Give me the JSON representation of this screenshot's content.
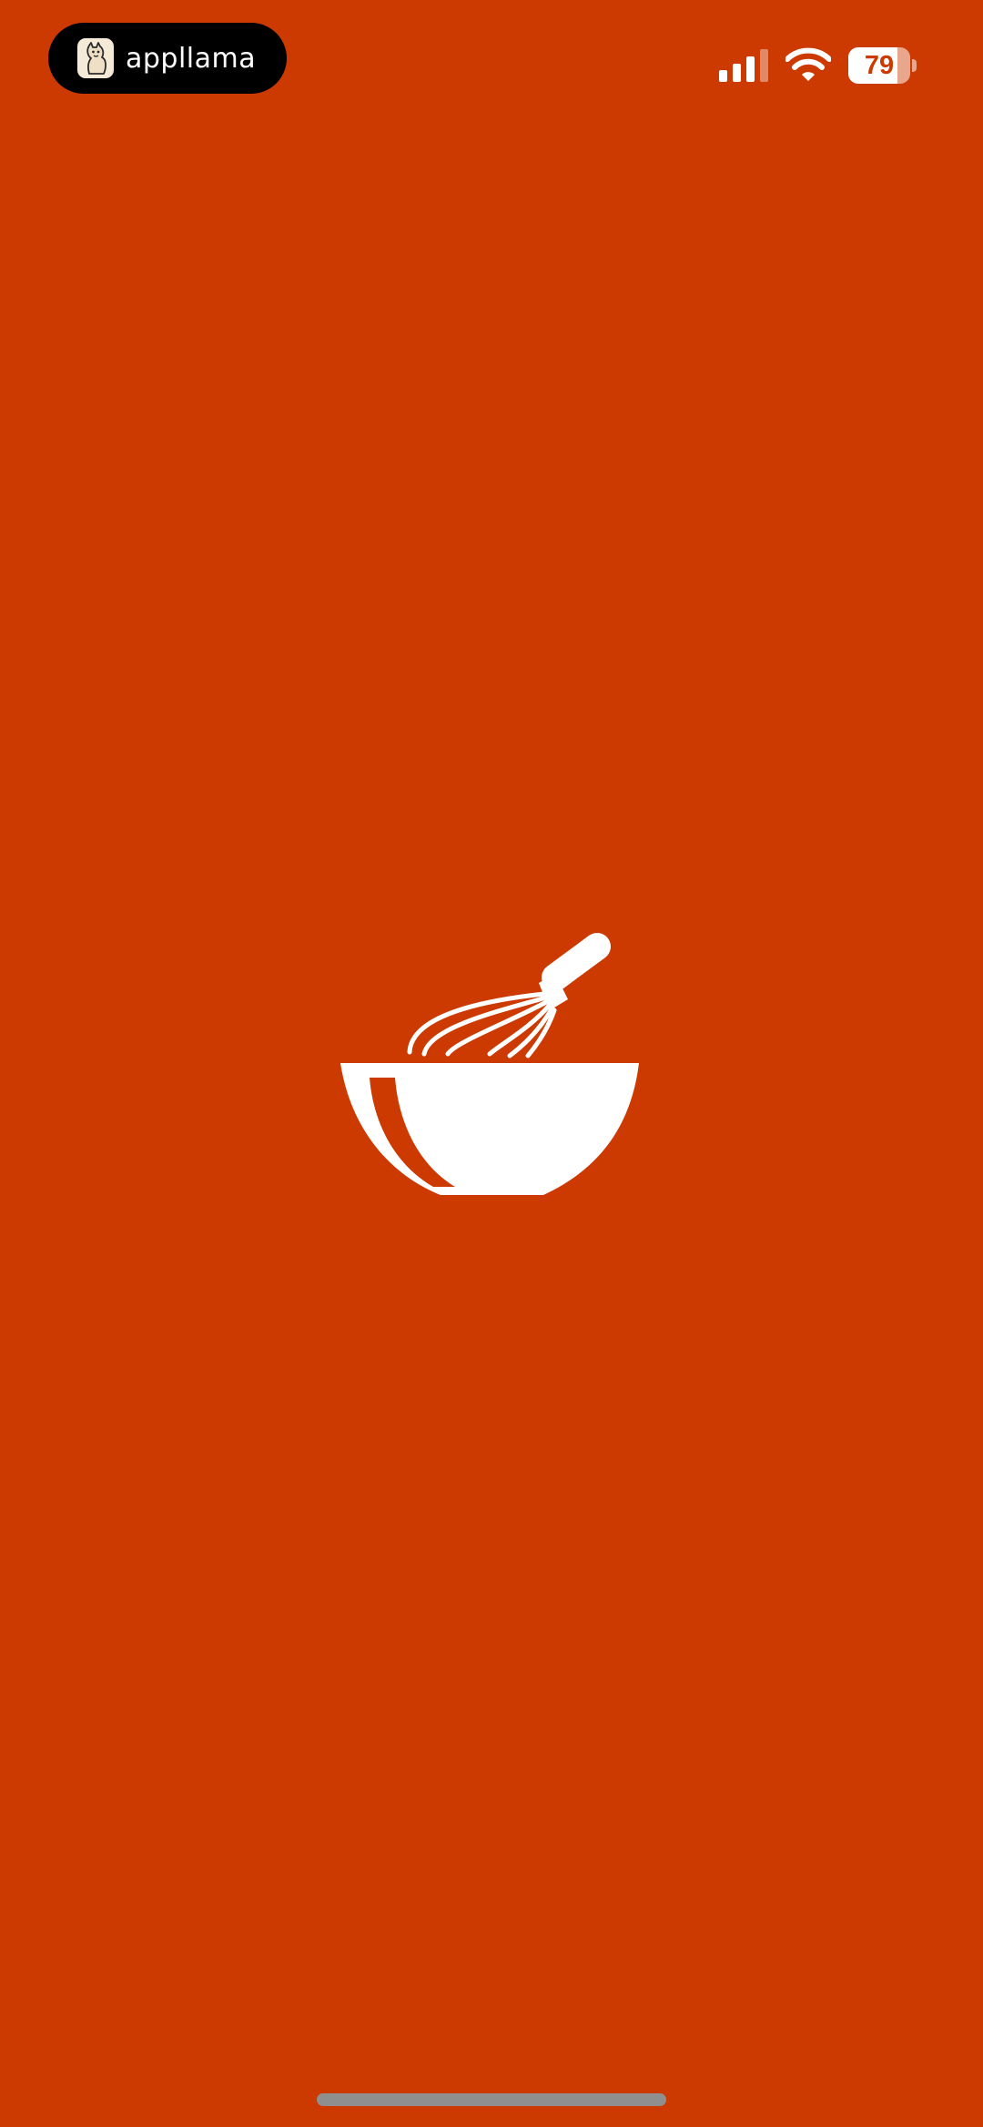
{
  "colors": {
    "background": "#CC3A02",
    "foreground": "#FFFFFF"
  },
  "status_bar": {
    "island_app_name": "appllama",
    "island_icon": "llama-icon",
    "battery_level": "79",
    "battery_fraction": 0.79,
    "signal_icon": "cellular-signal-icon",
    "wifi_icon": "wifi-icon"
  },
  "splash": {
    "logo_icon": "mixing-bowl-whisk-icon"
  }
}
